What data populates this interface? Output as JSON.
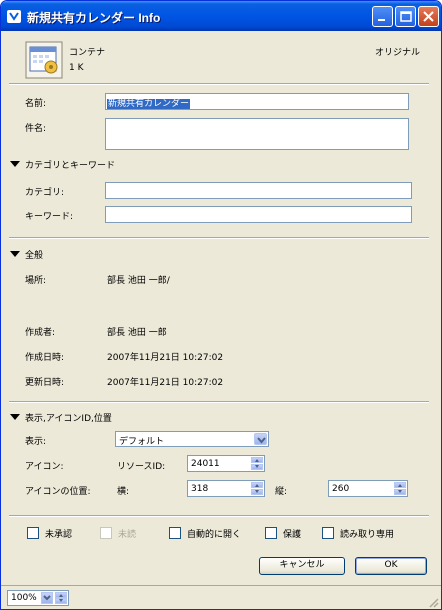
{
  "window": {
    "title": "新規共有カレンダー Info"
  },
  "header": {
    "kind": "コンテナ",
    "size": "1 K",
    "badge": "オリジナル"
  },
  "general": {
    "name_label": "名前:",
    "name_value": "新規共有カレンダー",
    "subject_label": "件名:",
    "subject_value": ""
  },
  "categories": {
    "title": "カテゴリとキーワード",
    "category_label": "カテゴリ:",
    "category_value": "",
    "keyword_label": "キーワード:",
    "keyword_value": ""
  },
  "overview": {
    "title": "全般",
    "location_label": "場所:",
    "location_value": "部長 池田 一郎/",
    "author_label": "作成者:",
    "author_value": "部長 池田 一郎",
    "created_label": "作成日時:",
    "created_value": "2007年11月21日 10:27:02",
    "modified_label": "更新日時:",
    "modified_value": "2007年11月21日 10:27:02"
  },
  "display": {
    "title": "表示,アイコンID,位置",
    "view_label": "表示:",
    "view_value": "デフォルト",
    "icon_label": "アイコン:",
    "resource_label": "リソースID:",
    "resource_value": "24011",
    "pos_label": "アイコンの位置:",
    "h_label": "横:",
    "h_value": "318",
    "v_label": "縦:",
    "v_value": "260"
  },
  "flags": [
    {
      "label": "未承認",
      "enabled": true,
      "checked": false
    },
    {
      "label": "未読",
      "enabled": false,
      "checked": false
    },
    {
      "label": "自動的に開く",
      "enabled": true,
      "checked": false
    },
    {
      "label": "保護",
      "enabled": true,
      "checked": false
    },
    {
      "label": "読み取り専用",
      "enabled": true,
      "checked": false
    }
  ],
  "buttons": {
    "cancel": "キャンセル",
    "ok": "OK"
  },
  "status": {
    "zoom": "100%"
  },
  "colors": {
    "titlebar": "#0055e5",
    "face": "#ece9d8",
    "selection": "#316ac5"
  }
}
